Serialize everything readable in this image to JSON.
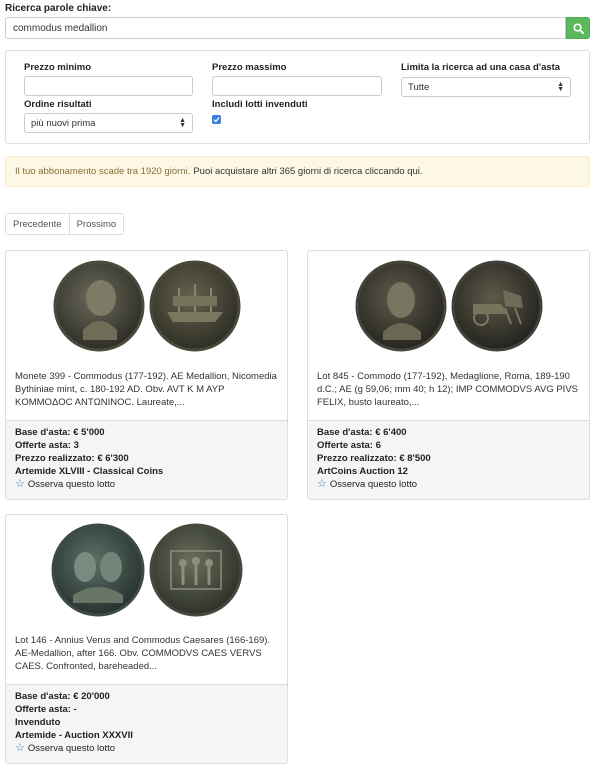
{
  "search": {
    "label": "Ricerca parole chiave:",
    "value": "commodus medallion"
  },
  "filters": {
    "min_price_label": "Prezzo minimo",
    "max_price_label": "Prezzo massimo",
    "house_label": "Limita la ricerca ad una casa d'asta",
    "house_value": "Tutte",
    "order_label": "Ordine risultati",
    "order_value": "più nuovi prima",
    "include_unsold_label": "Includi lotti invenduti",
    "include_unsold_checked": true
  },
  "alert": {
    "warning_text": "Il tuo abbonamento scade tra 1920 giorni.",
    "info_text": "Puoi acquistare altri 365 giorni di ricerca cliccando qui."
  },
  "pager": {
    "prev": "Precedente",
    "next": "Prossimo"
  },
  "results": [
    {
      "desc": "Monete 399 - Commodus (177-192). AE Medallion, Nicomedia Bythiniae mint, c. 180-192 AD. Obv. AVT K M AYP KOMMOΔOC ANTΩNINOC. Laureate,...",
      "base": "Base d'asta: € 5'000",
      "bids": "Offerte asta: 3",
      "realized": "Prezzo realizzato: € 6'300",
      "auction": "Artemide XLVIII - Classical Coins",
      "watch": "Osserva questo lotto"
    },
    {
      "desc": "Lot 845 - Commodo (177-192), Medaglione, Roma, 189-190 d.C.; AE (g 59,06; mm 40; h 12); IMP COMMODVS AVG PIVS FELIX, busto laureato,...",
      "base": "Base d'asta: € 6'400",
      "bids": "Offerte asta: 6",
      "realized": "Prezzo realizzato: € 8'500",
      "auction": "ArtCoins Auction 12",
      "watch": "Osserva questo lotto"
    },
    {
      "desc": "Lot 146 - Annius Verus and Commodus Caesares (166-169). AE-Medallion, after 166. Obv. COMMODVS CAES VERVS CAES. Confronted, bareheaded...",
      "base": "Base d'asta: € 20'000",
      "bids": "Offerte asta: -",
      "realized": "Invenduto",
      "auction": "Artemide - Auction XXXVII",
      "watch": "Osserva questo lotto"
    }
  ]
}
